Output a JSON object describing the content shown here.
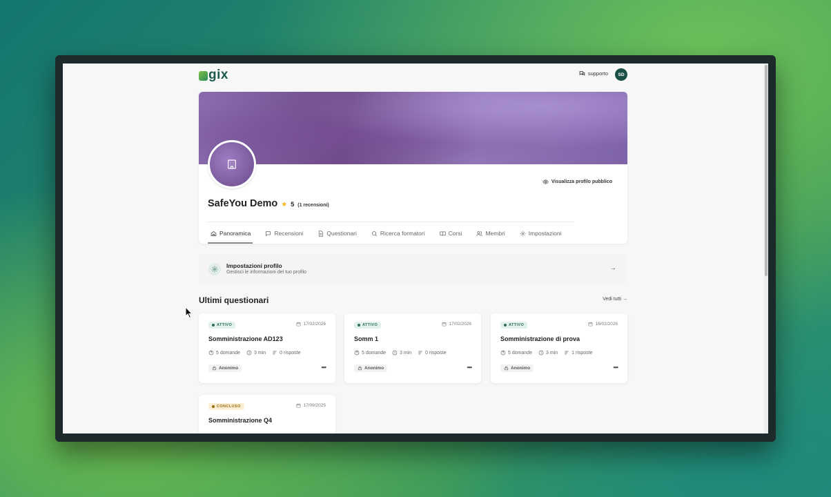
{
  "header": {
    "logo_text": "gix",
    "support_label": "supporto",
    "avatar_initials": "SD"
  },
  "profile": {
    "public_profile_link": "Visualizza profilo pubblico",
    "name": "SafeYou Demo",
    "rating": "5",
    "reviews": "(1 recensioni)"
  },
  "tabs": [
    {
      "label": "Panoramica",
      "icon": "home-icon",
      "active": true
    },
    {
      "label": "Recensioni",
      "icon": "chat-icon"
    },
    {
      "label": "Questionari",
      "icon": "document-icon"
    },
    {
      "label": "Ricerca formatori",
      "icon": "search-icon"
    },
    {
      "label": "Corsi",
      "icon": "book-icon"
    },
    {
      "label": "Membri",
      "icon": "users-icon"
    },
    {
      "label": "Impostazioni",
      "icon": "gear-icon"
    }
  ],
  "settings_row": {
    "title": "Impostazioni profilo",
    "subtitle": "Gestisci le informazioni del tuo profilo"
  },
  "questionnaires": {
    "title": "Ultimi questionari",
    "see_all": "Vedi tutti →",
    "cards": [
      {
        "status": "ATTIVO",
        "status_type": "active",
        "date": "17/02/2026",
        "title": "Somministrazione AD123",
        "questions": "5 domande",
        "duration": "3 min",
        "responses": "0 risposte",
        "anonymity": "Anonimo"
      },
      {
        "status": "ATTIVO",
        "status_type": "active",
        "date": "17/02/2026",
        "title": "Somm 1",
        "questions": "5 domande",
        "duration": "3 min",
        "responses": "0 risposte",
        "anonymity": "Anonimo"
      },
      {
        "status": "ATTIVO",
        "status_type": "active",
        "date": "16/02/2026",
        "title": "Somministrazione di prova",
        "questions": "5 domande",
        "duration": "3 min",
        "responses": "1 risposte",
        "anonymity": "Anonimo"
      },
      {
        "status": "CONCLUSO",
        "status_type": "done",
        "date": "17/09/2025",
        "title": "Somministrazione Q4"
      }
    ]
  },
  "colors": {
    "brand_dark": "#1d5a4c",
    "active_badge": "#2b6d5b",
    "done_badge": "#9b6a12"
  }
}
